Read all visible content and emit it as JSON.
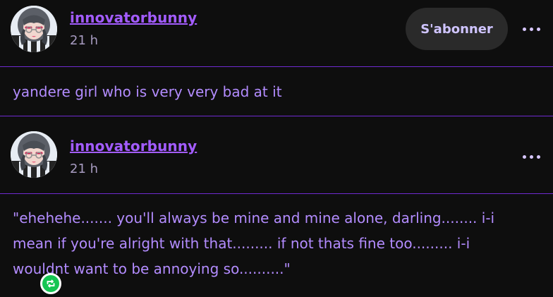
{
  "colors": {
    "background": "#0e0e0e",
    "accent": "#a35cff",
    "divider": "#6f2ad1",
    "text": "#b38cff",
    "subtle_text": "#a79bc0",
    "reblog_green": "#16c553"
  },
  "post": {
    "author": "innovatorbunny",
    "time": "21 h",
    "subscribe_label": "S'abonner",
    "menu_icon": "more-horizontal-icon",
    "text": "yandere girl who is very very bad at it"
  },
  "reblog": {
    "author": "innovatorbunny",
    "time": "21 h",
    "badge_icon": "reblog-icon",
    "menu_icon": "more-horizontal-icon",
    "text": "\"ehehehe....... you'll always be mine and mine alone, darling........ i-i mean if you're alright with that......... if not thats fine too......... i-i wouldnt want to be annoying so..........\""
  }
}
